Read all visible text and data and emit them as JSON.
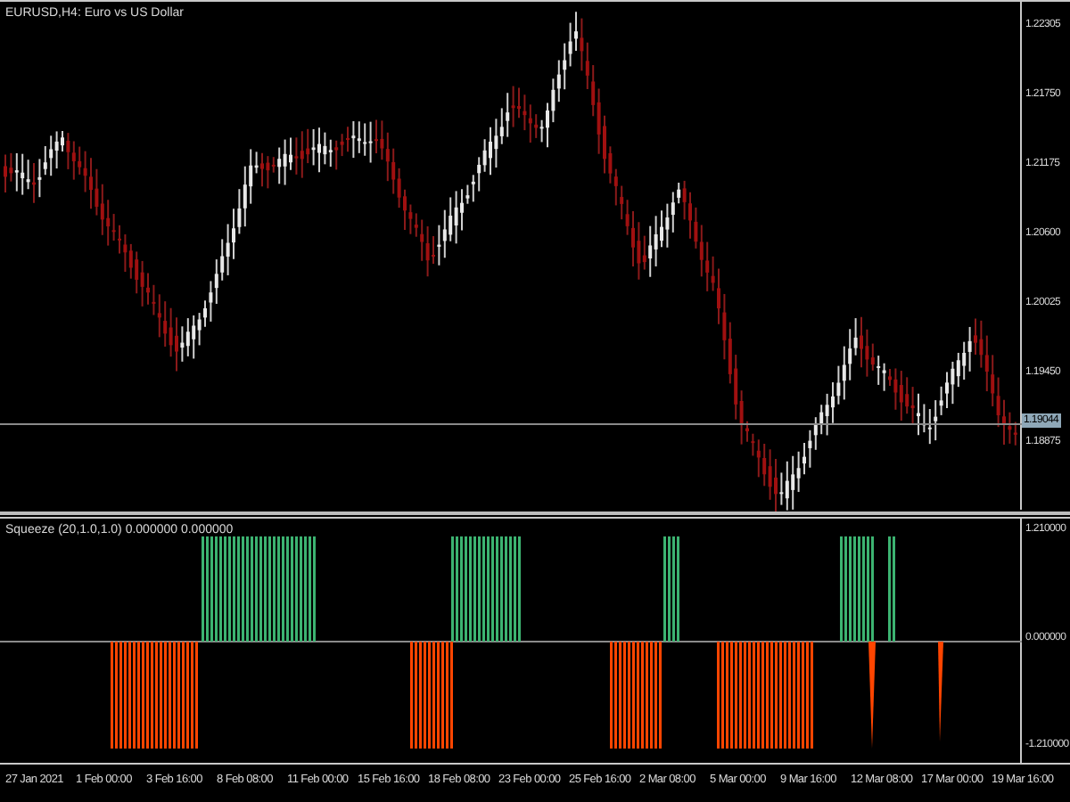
{
  "main_chart": {
    "title": "EURUSD,H4:  Euro vs US Dollar",
    "price_axis": [
      "1.22305",
      "1.21750",
      "1.21175",
      "1.20600",
      "1.20025",
      "1.19450",
      "1.18875"
    ],
    "current_price": "1.19044"
  },
  "indicator": {
    "title": "Squeeze (20,1.0,1.0) 0.000000 0.000000",
    "axis": [
      "1.210000",
      "0.000000",
      "-1.210000"
    ]
  },
  "time_axis": [
    "27 Jan 2021",
    "1 Feb 00:00",
    "3 Feb 16:00",
    "8 Feb 08:00",
    "11 Feb 00:00",
    "15 Feb 16:00",
    "18 Feb 08:00",
    "23 Feb 00:00",
    "25 Feb 16:00",
    "2 Mar 08:00",
    "5 Mar 00:00",
    "9 Mar 16:00",
    "12 Mar 08:00",
    "17 Mar 00:00",
    "19 Mar 16:00"
  ]
}
